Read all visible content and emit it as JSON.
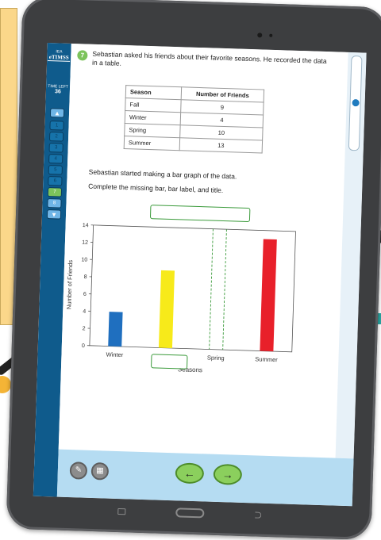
{
  "app": {
    "logo_org": "IEA",
    "logo_name": "eTIMSS"
  },
  "timer": {
    "label": "TIME LEFT",
    "value": "36"
  },
  "navigation": {
    "items": [
      "1",
      "2",
      "3",
      "4",
      "5",
      "6",
      "7",
      "8"
    ],
    "current": "7"
  },
  "question": {
    "number": "7",
    "prompt": "Sebastian asked his friends about their favorite seasons. He recorded the data in a table.",
    "instruction_1": "Sebastian started making a bar graph of the data.",
    "instruction_2": "Complete the missing bar, bar label, and title."
  },
  "table": {
    "headers": [
      "Season",
      "Number of Friends"
    ],
    "rows": [
      [
        "Fall",
        "9"
      ],
      [
        "Winter",
        "4"
      ],
      [
        "Spring",
        "10"
      ],
      [
        "Summer",
        "13"
      ]
    ]
  },
  "chart_data": {
    "type": "bar",
    "title": "",
    "xlabel": "Seasons",
    "ylabel": "Number of Friends",
    "categories": [
      "Winter",
      "",
      "Spring",
      "Summer"
    ],
    "values": [
      4,
      9,
      null,
      13
    ],
    "colors": [
      "#1f6fbf",
      "#f7ea1a",
      "#3a9a3a",
      "#e8202a"
    ],
    "ylim": [
      0,
      14
    ],
    "yticks": [
      0,
      2,
      4,
      6,
      8,
      10,
      12,
      14
    ],
    "dashed_placeholder_category": "Spring",
    "grid": false
  },
  "colors": {
    "sidebar": "#0f5b8c",
    "accent_green": "#7cc35b",
    "bottom_bar": "#b5dcf2"
  },
  "icons": {
    "tool_left": "ruler-icon",
    "tool_right": "calculator-icon",
    "back": "arrow-left-icon",
    "next": "arrow-right-icon"
  }
}
